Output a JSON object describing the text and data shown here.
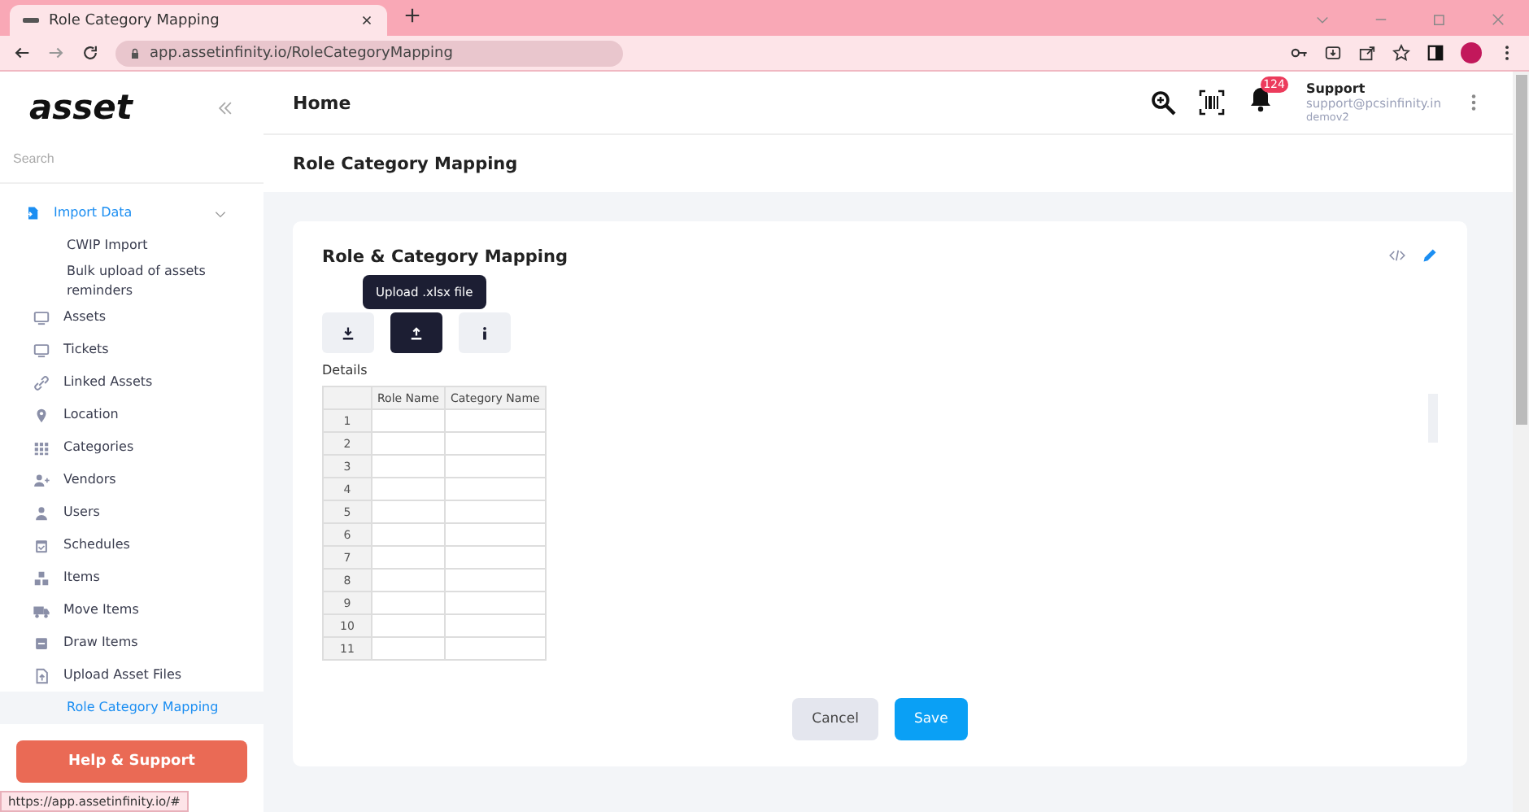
{
  "browser": {
    "tab_title": "Role Category Mapping",
    "url": "app.assetinfinity.io/RoleCategoryMapping",
    "status_url": "https://app.assetinfinity.io/#"
  },
  "sidebar": {
    "logo": "asset",
    "search_placeholder": "Search",
    "items": [
      {
        "label": "Import Data",
        "kind": "group",
        "selected": false,
        "expanded": true
      },
      {
        "label": "CWIP Import",
        "kind": "child",
        "selected": false
      },
      {
        "label": "Bulk upload of assets reminders",
        "kind": "child",
        "selected": false
      },
      {
        "label": "Assets",
        "kind": "item",
        "selected": false
      },
      {
        "label": "Tickets",
        "kind": "item",
        "selected": false
      },
      {
        "label": "Linked Assets",
        "kind": "item",
        "selected": false
      },
      {
        "label": "Location",
        "kind": "item",
        "selected": false
      },
      {
        "label": "Categories",
        "kind": "item",
        "selected": false
      },
      {
        "label": "Vendors",
        "kind": "item",
        "selected": false
      },
      {
        "label": "Users",
        "kind": "item",
        "selected": false
      },
      {
        "label": "Schedules",
        "kind": "item",
        "selected": false
      },
      {
        "label": "Items",
        "kind": "item",
        "selected": false
      },
      {
        "label": "Move Items",
        "kind": "item",
        "selected": false
      },
      {
        "label": "Draw Items",
        "kind": "item",
        "selected": false
      },
      {
        "label": "Upload Asset Files",
        "kind": "item",
        "selected": false
      },
      {
        "label": "Role Category Mapping",
        "kind": "child",
        "selected": true
      }
    ],
    "help_button": "Help & Support"
  },
  "header": {
    "title": "Home",
    "notification_count": "124",
    "user_name": "Support",
    "user_email": "support@pcsinfinity.in",
    "user_tenant": "demov2"
  },
  "page_title": "Role Category Mapping",
  "card": {
    "title": "Role & Category Mapping",
    "tooltip": "Upload .xlsx file",
    "tool_buttons": [
      {
        "kind": "download",
        "selected": false
      },
      {
        "kind": "upload",
        "selected": true
      },
      {
        "kind": "info",
        "selected": false
      }
    ],
    "details_label": "Details",
    "table": {
      "columns": [
        "Role Name",
        "Category Name"
      ],
      "row_numbers": [
        "1",
        "2",
        "3",
        "4",
        "5",
        "6",
        "7",
        "8",
        "9",
        "10",
        "11"
      ]
    },
    "buttons": [
      {
        "label": "Cancel",
        "kind": "secondary"
      },
      {
        "label": "Save",
        "kind": "primary"
      }
    ]
  }
}
